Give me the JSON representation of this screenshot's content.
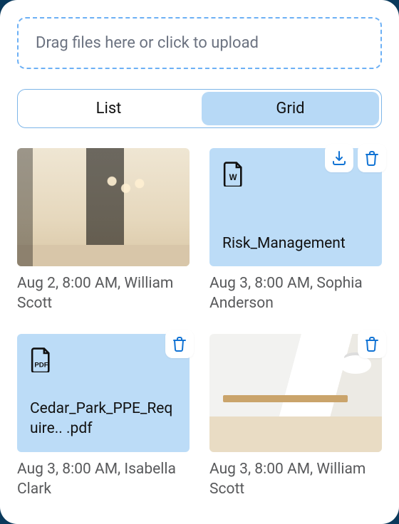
{
  "upload": {
    "placeholder": "Drag files here or click to upload"
  },
  "view": {
    "list": "List",
    "grid": "Grid",
    "active": "grid"
  },
  "cards": [
    {
      "kind": "image",
      "imageStyle": "kitchen",
      "meta": "Aug 2, 8:00 AM, William Scott",
      "actions": []
    },
    {
      "kind": "file",
      "fileType": "word",
      "name": "Risk_Management",
      "meta": "Aug 3, 8:00 AM, Sophia Anderson",
      "actions": [
        "download",
        "delete"
      ]
    },
    {
      "kind": "file",
      "fileType": "pdf",
      "name": "Cedar_Park_PPE_Require.. .pdf",
      "meta": "Aug 3, 8:00 AM, Isabella Clark",
      "actions": [
        "delete"
      ]
    },
    {
      "kind": "image",
      "imageStyle": "dining",
      "meta": "Aug 3, 8:00 AM, William Scott",
      "actions": [
        "delete"
      ]
    }
  ]
}
